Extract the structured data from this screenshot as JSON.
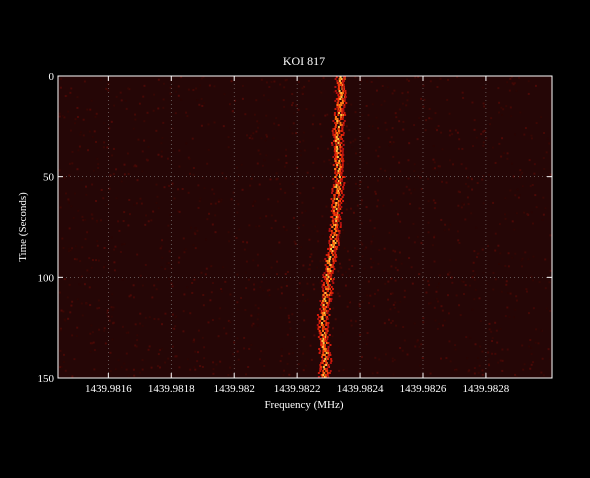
{
  "chart_data": {
    "type": "heatmap",
    "title": "KOI 817",
    "xlabel": "Frequency (MHz)",
    "ylabel": "Time (Seconds)",
    "xlim": [
      1439.98144,
      1439.98301
    ],
    "ylim": [
      0,
      150
    ],
    "y_inverted": true,
    "grid": true,
    "colormap": "hot",
    "background_color": "#250606",
    "grid_color": "#8a8a8a",
    "x_ticks": [
      1439.9816,
      1439.9818,
      1439.982,
      1439.9822,
      1439.9824,
      1439.9826,
      1439.9828
    ],
    "x_tick_labels": [
      "1439.9816",
      "1439.9818",
      "1439.982",
      "1439.9822",
      "1439.9824",
      "1439.9826",
      "1439.9828"
    ],
    "y_ticks": [
      0,
      50,
      100,
      150
    ],
    "y_tick_labels": [
      "0",
      "50",
      "100",
      "150"
    ],
    "signal_track": {
      "description_values": "drifting narrowband signal: frequency (MHz) at time (s)",
      "time": [
        0,
        10,
        20,
        30,
        40,
        50,
        60,
        70,
        80,
        90,
        100,
        110,
        120,
        130,
        140,
        150
      ],
      "frequency": [
        1439.982335,
        1439.982338,
        1439.982332,
        1439.982325,
        1439.98233,
        1439.98233,
        1439.982325,
        1439.98232,
        1439.982315,
        1439.982305,
        1439.982295,
        1439.98229,
        1439.98228,
        1439.982282,
        1439.982288,
        1439.982283
      ]
    }
  }
}
